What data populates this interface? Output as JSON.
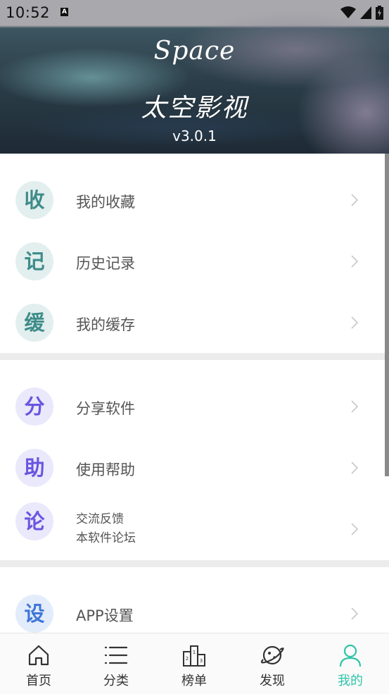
{
  "status_bar": {
    "time": "10:52",
    "notification": "A"
  },
  "header": {
    "logo": "Space",
    "app_name": "太空影视",
    "version": "v3.0.1"
  },
  "sections": [
    {
      "items": [
        {
          "badge": "收",
          "label": "我的收藏",
          "color": "#3f8c8a"
        },
        {
          "badge": "记",
          "label": "历史记录",
          "color": "#3f8c8a"
        },
        {
          "badge": "缓",
          "label": "我的缓存",
          "color": "#3f8c8a"
        }
      ]
    },
    {
      "items": [
        {
          "badge": "分",
          "label": "分享软件",
          "color": "#6a55e0"
        },
        {
          "badge": "助",
          "label": "使用帮助",
          "color": "#6a55e0"
        },
        {
          "badge": "论",
          "label_line1": "交流反馈",
          "label_line2": "本软件论坛",
          "color": "#6a55e0"
        }
      ]
    },
    {
      "items": [
        {
          "badge": "设",
          "label": "APP设置",
          "color": "#3f77d8"
        }
      ]
    }
  ],
  "tabbar": {
    "active_color": "#2ec4a8",
    "tabs": [
      {
        "label": "首页",
        "icon": "home-icon"
      },
      {
        "label": "分类",
        "icon": "list-icon"
      },
      {
        "label": "榜单",
        "icon": "podium-icon"
      },
      {
        "label": "发现",
        "icon": "planet-icon"
      },
      {
        "label": "我的",
        "icon": "user-icon",
        "active": true
      }
    ]
  }
}
